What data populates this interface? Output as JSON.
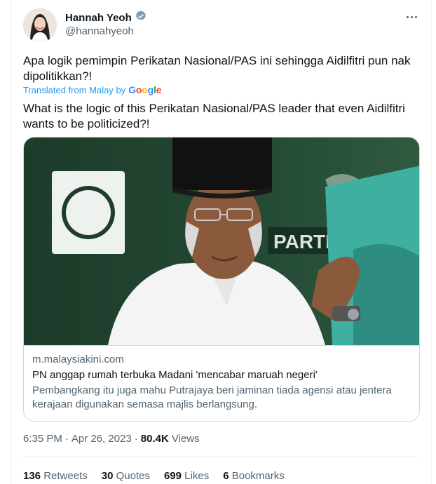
{
  "author": {
    "name": "Hannah Yeoh",
    "handle": "@hannahyeoh",
    "verified_icon": "verified-badge-icon"
  },
  "tweet": {
    "original_text": "Apa logik pemimpin Perikatan Nasional/PAS ini sehingga Aidilfitri pun nak dipolitikkan?!",
    "translated_from": "Translated from Malay by",
    "translator": "Google",
    "translated_text": "What is the logic of this Perikatan Nasional/PAS leader that even Aidilfitri wants to be politicized?!"
  },
  "card": {
    "domain": "m.malaysiakini.com",
    "title": "PN anggap rumah terbuka Madani 'mencabar maruah negeri'",
    "description": "Pembangkang itu juga mahu Putrajaya beri jaminan tiada agensi atau jentera kerajaan digunakan semasa majlis berlangsung.",
    "image_text": "PARTI I"
  },
  "meta": {
    "time": "6:35 PM",
    "sep": "·",
    "date": "Apr 26, 2023",
    "views_count": "80.4K",
    "views_label": "Views"
  },
  "stats": [
    {
      "count": "136",
      "label": "Retweets"
    },
    {
      "count": "30",
      "label": "Quotes"
    },
    {
      "count": "699",
      "label": "Likes"
    },
    {
      "count": "6",
      "label": "Bookmarks"
    }
  ],
  "colors": {
    "accent": "#1d9bf0",
    "secondary_text": "#536471",
    "primary_text": "#0f1419"
  }
}
